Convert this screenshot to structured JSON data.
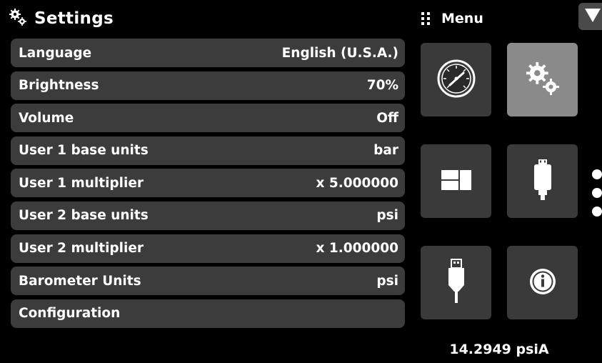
{
  "settings": {
    "title": "Settings",
    "icon": "gears-icon",
    "rows": [
      {
        "label": "Language",
        "value": "English (U.S.A.)"
      },
      {
        "label": "Brightness",
        "value": "70%"
      },
      {
        "label": "Volume",
        "value": "Off"
      },
      {
        "label": "User 1 base units",
        "value": "bar"
      },
      {
        "label": "User 1 multiplier",
        "value": "x 5.000000"
      },
      {
        "label": "User 2 base units",
        "value": "psi"
      },
      {
        "label": "User 2 multiplier",
        "value": "x 1.000000"
      },
      {
        "label": "Barometer Units",
        "value": "psi"
      },
      {
        "label": "Configuration",
        "value": ""
      }
    ]
  },
  "menu": {
    "label": "Menu",
    "grip_icon": "grip-icon",
    "dropdown_icon": "triangle-down-icon",
    "tiles": [
      {
        "name": "gauge",
        "icon": "gauge-icon",
        "active": false
      },
      {
        "name": "settings",
        "icon": "gears-icon",
        "active": true
      },
      {
        "name": "display",
        "icon": "display-layout-icon",
        "active": false
      },
      {
        "name": "transducer",
        "icon": "transducer-icon",
        "active": false
      },
      {
        "name": "usb",
        "icon": "usb-icon",
        "active": false
      },
      {
        "name": "info",
        "icon": "info-icon",
        "active": false
      }
    ],
    "page_count": 3
  },
  "status": {
    "barometer_reading": "14.2949 psiA"
  },
  "colors": {
    "background": "#000000",
    "row_bg": "#3c3c3c",
    "tile_bg": "#3a3a3a",
    "tile_active_bg": "#8a8a8a",
    "text": "#ffffff"
  }
}
